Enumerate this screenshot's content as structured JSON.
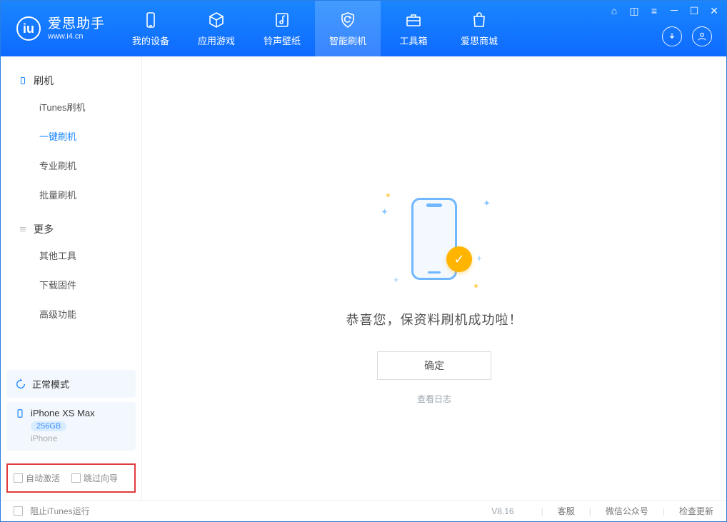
{
  "brand": {
    "title": "爱思助手",
    "url": "www.i4.cn"
  },
  "nav": {
    "items": [
      {
        "key": "device",
        "label": "我的设备"
      },
      {
        "key": "apps",
        "label": "应用游戏"
      },
      {
        "key": "rings",
        "label": "铃声壁纸"
      },
      {
        "key": "flash",
        "label": "智能刷机"
      },
      {
        "key": "tools",
        "label": "工具箱"
      },
      {
        "key": "store",
        "label": "爱思商城"
      }
    ],
    "active_index": 3
  },
  "sidebar": {
    "section_flash": "刷机",
    "section_more": "更多",
    "flash_items": [
      {
        "label": "iTunes刷机"
      },
      {
        "label": "一键刷机"
      },
      {
        "label": "专业刷机"
      },
      {
        "label": "批量刷机"
      }
    ],
    "flash_active_index": 1,
    "more_items": [
      {
        "label": "其他工具"
      },
      {
        "label": "下载固件"
      },
      {
        "label": "高级功能"
      }
    ],
    "mode_label": "正常模式",
    "device": {
      "name": "iPhone XS Max",
      "storage": "256GB",
      "subtype": "iPhone"
    },
    "options": {
      "auto_activate": "自动激活",
      "skip_guide": "跳过向导"
    }
  },
  "main": {
    "success_text": "恭喜您，保资料刷机成功啦！",
    "confirm_btn": "确定",
    "view_log": "查看日志"
  },
  "footer": {
    "block_itunes": "阻止iTunes运行",
    "version": "V8.16",
    "support": "客服",
    "wechat": "微信公众号",
    "check_update": "检查更新"
  }
}
